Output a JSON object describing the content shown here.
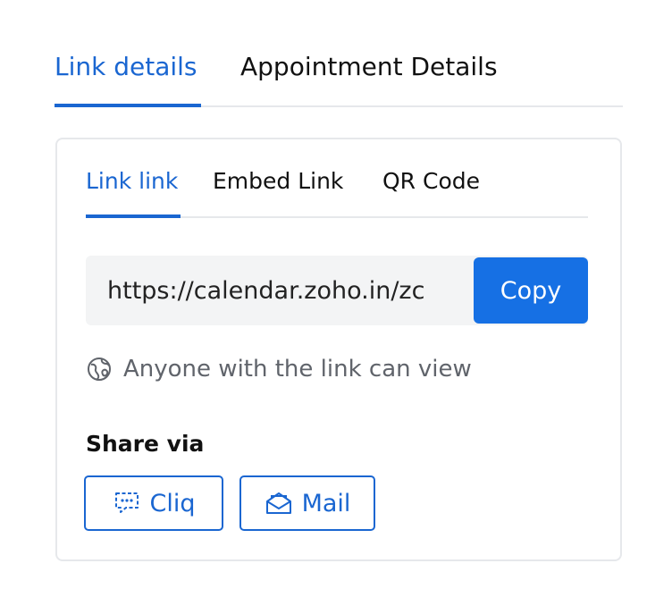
{
  "top_tabs": [
    {
      "label": "Link details",
      "active": true
    },
    {
      "label": "Appointment Details",
      "active": false
    }
  ],
  "sub_tabs": [
    {
      "label": "Link link",
      "active": true
    },
    {
      "label": "Embed Link",
      "active": false
    },
    {
      "label": "QR Code",
      "active": false
    }
  ],
  "link": {
    "url": "https://calendar.zoho.in/zc",
    "copy_label": "Copy"
  },
  "visibility": {
    "icon": "globe-icon",
    "text": "Anyone with the link can view"
  },
  "share": {
    "label": "Share via",
    "options": [
      {
        "label": "Cliq",
        "icon": "chat-icon"
      },
      {
        "label": "Mail",
        "icon": "mail-icon"
      }
    ]
  },
  "colors": {
    "accent": "#1a66d1",
    "copy_button": "#1670e4",
    "muted_text": "#60646b",
    "border": "#e6e8eb",
    "link_box_bg": "#f3f4f5"
  }
}
